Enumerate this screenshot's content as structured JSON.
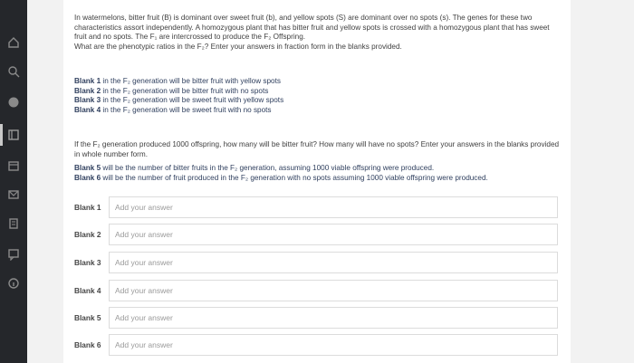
{
  "question": {
    "p1": "In watermelons, bitter fruit (B) is dominant over sweet fruit (b), and yellow spots (S) are dominant over no spots (s). The genes for these two characteristics assort independently. A homozygous plant that has bitter fruit and yellow spots is crossed with a homozygous plant that has sweet fruit and no spots. The F₁ are intercrossed to produce the F₂ Offspring.",
    "p1b": "What are the phenotypic ratios in the F₂? Enter your answers in fraction form in the blanks provided.",
    "blanks_desc": [
      {
        "label": "Blank 1",
        "text": " in the F₂ generation will be bitter fruit with yellow spots"
      },
      {
        "label": "Blank 2",
        "text": " in the F₂ generation will be bitter fruit with no spots"
      },
      {
        "label": "Blank 3",
        "text": " in the F₂ generation will be sweet fruit with yellow spots"
      },
      {
        "label": "Blank 4",
        "text": " in the F₂ generation will be sweet fruit with no spots"
      }
    ],
    "p2": "If the F₂ generation produced 1000 offspring, how many will be bitter fruit? How many will have no spots? Enter your answers in the blanks provided in whole number form.",
    "p3": [
      {
        "label": "Blank 5",
        "text": " will be the number of bitter fruits in the F₂ generation, assuming 1000 viable offspring were produced."
      },
      {
        "label": "Blank 6",
        "text": " will be the number of fruit produced in the F₂ generation with no spots assuming 1000 viable offspring were produced."
      }
    ]
  },
  "answers": [
    {
      "label": "Blank 1",
      "placeholder": "Add your answer",
      "value": ""
    },
    {
      "label": "Blank 2",
      "placeholder": "Add your answer",
      "value": ""
    },
    {
      "label": "Blank 3",
      "placeholder": "Add your answer",
      "value": ""
    },
    {
      "label": "Blank 4",
      "placeholder": "Add your answer",
      "value": ""
    },
    {
      "label": "Blank 5",
      "placeholder": "Add your answer",
      "value": ""
    },
    {
      "label": "Blank 6",
      "placeholder": "Add your answer",
      "value": ""
    }
  ],
  "sidebar_icons": [
    "home-icon",
    "search-icon",
    "globe-icon",
    "book-icon",
    "calendar-icon",
    "mail-icon",
    "document-icon",
    "chat-icon",
    "help-icon"
  ],
  "colors": {
    "sidebar": "#25272b",
    "accent_text": "#2f3f5e",
    "background": "#f2f2f2"
  }
}
